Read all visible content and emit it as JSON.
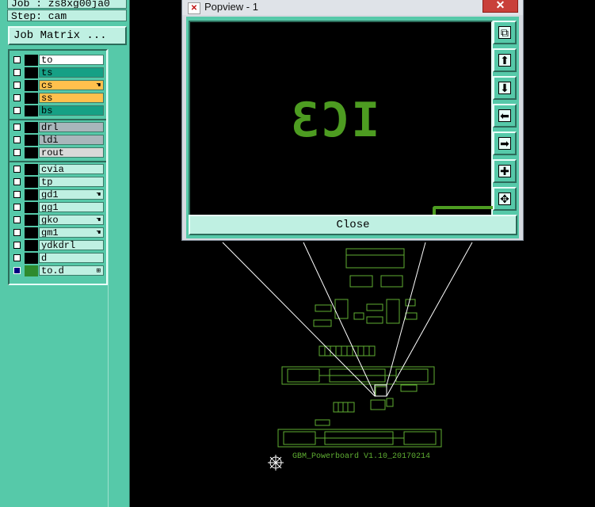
{
  "left_panel": {
    "job_line": "Job : zs8xg00ja0",
    "step_line": "Step: cam",
    "job_matrix_label": "Job Matrix ...",
    "layers": [
      {
        "name": "to",
        "bg": "#ffffff",
        "mark": ""
      },
      {
        "name": "ts",
        "bg": "#16a085",
        "mark": ""
      },
      {
        "name": "cs",
        "bg": "#ffc04d",
        "mark": "hand"
      },
      {
        "name": "ss",
        "bg": "#ffc04d",
        "mark": ""
      },
      {
        "name": "bs",
        "bg": "#16a085",
        "mark": ""
      },
      {
        "name": "drl",
        "bg": "#a9b6bb",
        "mark": ""
      },
      {
        "name": "ldi",
        "bg": "#a9b6bb",
        "mark": ""
      },
      {
        "name": "rout",
        "bg": "#d9d9d9",
        "mark": ""
      },
      {
        "name": "cvia",
        "bg": "#bff0e2",
        "mark": ""
      },
      {
        "name": "tp",
        "bg": "#bff0e2",
        "mark": ""
      },
      {
        "name": "gd1",
        "bg": "#bff0e2",
        "mark": "hand"
      },
      {
        "name": "gg1",
        "bg": "#bff0e2",
        "mark": ""
      },
      {
        "name": "gko",
        "bg": "#bff0e2",
        "mark": "hand"
      },
      {
        "name": "gm1",
        "bg": "#bff0e2",
        "mark": "hand"
      },
      {
        "name": "ydkdrl",
        "bg": "#bff0e2",
        "mark": ""
      },
      {
        "name": "d",
        "bg": "#bff0e2",
        "mark": ""
      },
      {
        "name": "to.d",
        "bg": "#bff0e2",
        "mark": "box"
      }
    ]
  },
  "popview": {
    "title": "Popview - 1",
    "close_x": "✕",
    "preview_text": "IC3",
    "close_button": "Close",
    "toolbar": [
      {
        "icon": "zoom-fit-icon",
        "glyph": "⧉"
      },
      {
        "icon": "pan-up-icon",
        "glyph": "⬆"
      },
      {
        "icon": "pan-down-icon",
        "glyph": "⬇"
      },
      {
        "icon": "pan-left-icon",
        "glyph": "⬅"
      },
      {
        "icon": "pan-right-icon",
        "glyph": "➡"
      },
      {
        "icon": "zoom-in-icon",
        "glyph": "✚"
      },
      {
        "icon": "zoom-out-icon",
        "glyph": "✥"
      }
    ]
  },
  "board": {
    "label": "GBM_Powerboard V1.10_20170214",
    "trace_color": "#4d9c21",
    "outline_color": "#6fbf3a"
  },
  "colors": {
    "panel": "#56c9a9",
    "field": "#bff0e2",
    "selected": "#000080"
  }
}
